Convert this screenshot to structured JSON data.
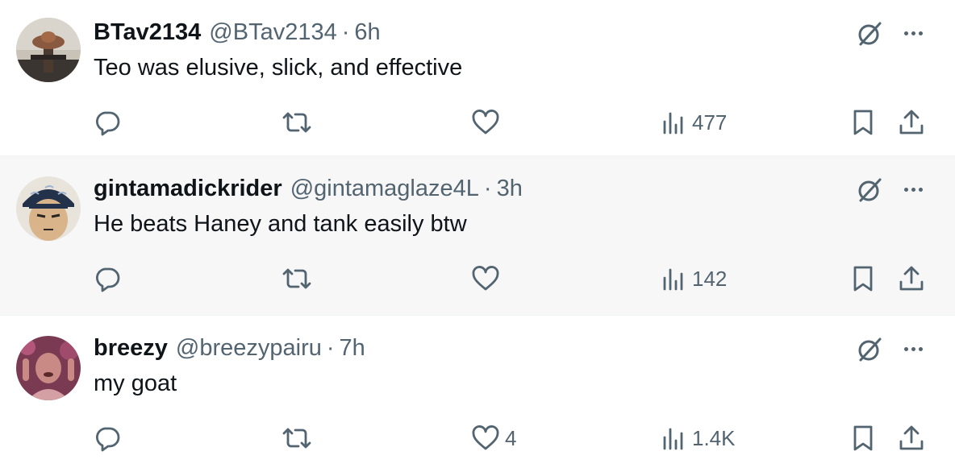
{
  "colors": {
    "text": "#0f1419",
    "secondary": "#536471",
    "highlight_row": "#f7f7f7"
  },
  "tweets": [
    {
      "name": "BTav2134",
      "handle": "@BTav2134",
      "separator": "·",
      "time": "6h",
      "text": "Teo was elusive, slick, and effective",
      "likes": "",
      "views": "477"
    },
    {
      "name": "gintamadickrider",
      "handle": "@gintamaglaze4L",
      "separator": "·",
      "time": "3h",
      "text": "He beats Haney and tank easily btw",
      "likes": "",
      "views": "142"
    },
    {
      "name": "breezy",
      "handle": "@breezypairu",
      "separator": "·",
      "time": "7h",
      "text": "my goat",
      "likes": "4",
      "views": "1.4K"
    }
  ],
  "icons": [
    "grok-icon",
    "more-icon",
    "reply-icon",
    "retweet-icon",
    "like-icon",
    "views-icon",
    "bookmark-icon",
    "share-icon"
  ]
}
